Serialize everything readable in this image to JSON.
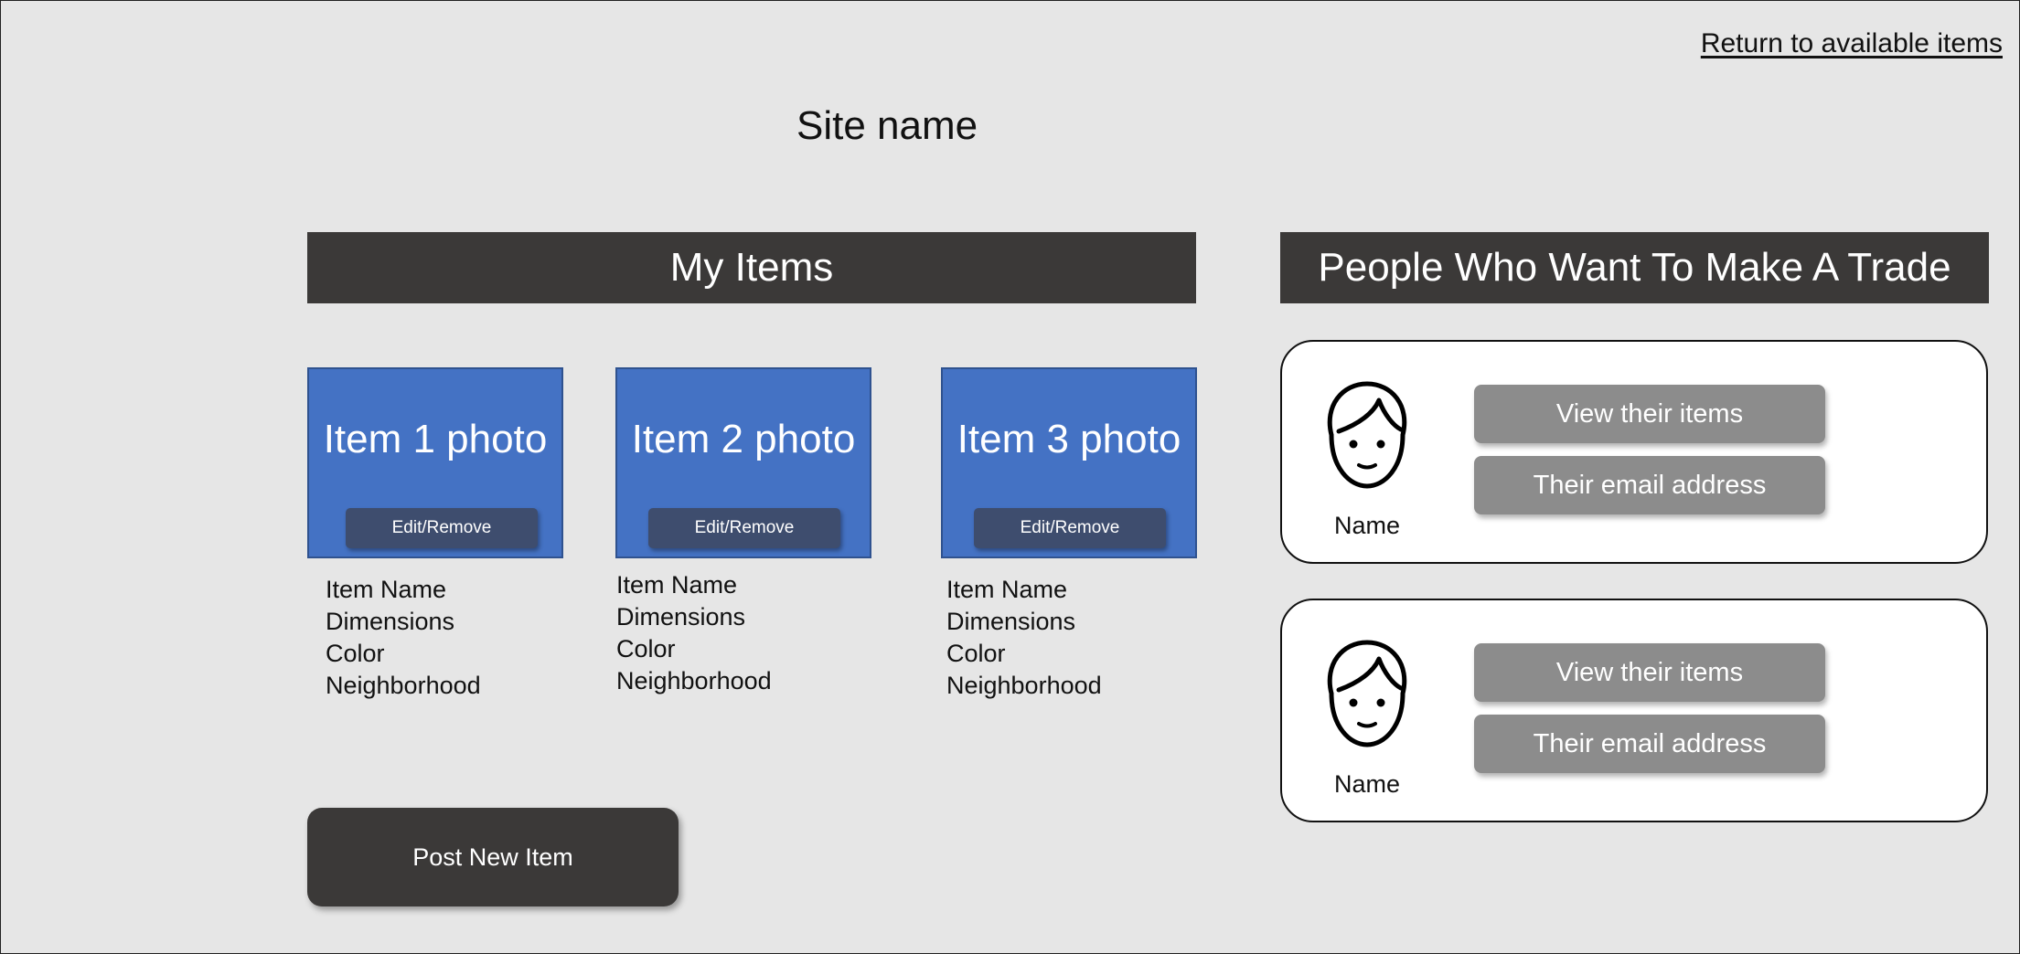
{
  "header": {
    "return_link": "Return to available items",
    "site_name": "Site name"
  },
  "my_items": {
    "title": "My Items",
    "items": [
      {
        "photo_label": "Item 1 photo",
        "edit_label": "Edit/Remove",
        "name": "Item Name",
        "dimensions": "Dimensions",
        "color": "Color",
        "neighborhood": "Neighborhood"
      },
      {
        "photo_label": "Item 2 photo",
        "edit_label": "Edit/Remove",
        "name": "Item Name",
        "dimensions": "Dimensions",
        "color": "Color",
        "neighborhood": "Neighborhood"
      },
      {
        "photo_label": "Item 3 photo",
        "edit_label": "Edit/Remove",
        "name": "Item Name",
        "dimensions": "Dimensions",
        "color": "Color",
        "neighborhood": "Neighborhood"
      }
    ],
    "post_button": "Post New Item"
  },
  "trades": {
    "title": "People Who Want To Make A Trade",
    "people": [
      {
        "name": "Name",
        "view_items_label": "View their items",
        "email_label": "Their email address",
        "avatar_icon": "person-face-icon"
      },
      {
        "name": "Name",
        "view_items_label": "View their items",
        "email_label": "Their email address",
        "avatar_icon": "person-face-icon"
      }
    ]
  },
  "colors": {
    "background": "#e6e6e6",
    "dark_bar": "#3b3938",
    "item_card": "#4472c4",
    "edit_button": "#3e4d6e",
    "gray_button": "#8c8c8c",
    "card_background": "#ffffff"
  }
}
